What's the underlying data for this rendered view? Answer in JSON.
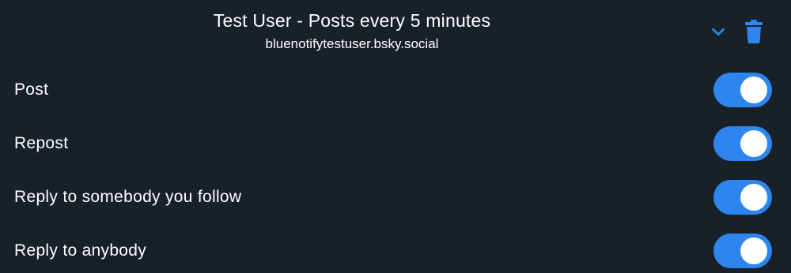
{
  "account": {
    "display_name": "Test User - Posts every 5 minutes",
    "handle": "bluenotifytestuser.bsky.social",
    "expand_icon": "chevron-down-icon",
    "delete_icon": "trash-icon"
  },
  "settings": [
    {
      "label": "Post",
      "enabled": true
    },
    {
      "label": "Repost",
      "enabled": true
    },
    {
      "label": "Reply to somebody you follow",
      "enabled": true
    },
    {
      "label": "Reply to anybody",
      "enabled": true
    }
  ],
  "colors": {
    "background": "#18202a",
    "accent": "#2c86ee",
    "text": "#ffffff",
    "knob": "#ffffff"
  }
}
